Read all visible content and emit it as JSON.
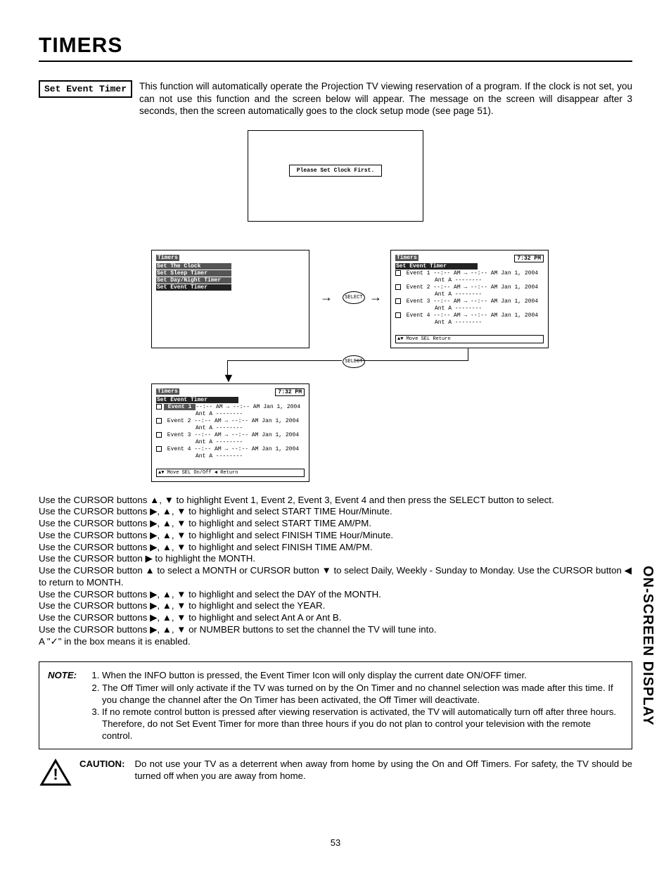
{
  "title": "TIMERS",
  "boxlabel": "Set Event Timer",
  "intro": "This function will automatically operate the Projection TV viewing reservation of a program.  If the clock is not set, you can not use this function and the screen below will appear.  The message on the screen will disappear after 3 seconds, then the screen automatically goes to the clock setup mode (see page 51).",
  "osd_simple": "Please Set Clock First.",
  "menu1": {
    "header": "Timers",
    "items": [
      "Set The Clock",
      "Set Sleep Timer",
      "Set Day/Night Timer",
      "Set Event Timer"
    ]
  },
  "menu2": {
    "header": "Timers",
    "sub": "Set Event Timer",
    "time": "7:32 PM",
    "events": [
      {
        "n": "Event 1",
        "t": "--:-- AM → --:-- AM Jan 1, 2004",
        "sub": "Ant A --------"
      },
      {
        "n": "Event 2",
        "t": "--:-- AM → --:-- AM Jan 1, 2004",
        "sub": "Ant A --------"
      },
      {
        "n": "Event 3",
        "t": "--:-- AM → --:-- AM Jan 1, 2004",
        "sub": "Ant A --------"
      },
      {
        "n": "Event 4",
        "t": "--:-- AM → --:-- AM Jan 1, 2004",
        "sub": "Ant A --------"
      }
    ],
    "footer": "▲▼ Move  SEL Return"
  },
  "menu3": {
    "header": "Timers",
    "sub": "Set Event Timer",
    "time": "7:32 PM",
    "events": [
      {
        "n": "Event 1",
        "t": "--:-- AM → --:-- AM Jan 1, 2004",
        "sub": "Ant A --------",
        "hl": true
      },
      {
        "n": "Event 2",
        "t": "--:-- AM → --:-- AM Jan 1, 2004",
        "sub": "Ant A --------"
      },
      {
        "n": "Event 3",
        "t": "--:-- AM → --:-- AM Jan 1, 2004",
        "sub": "Ant A --------"
      },
      {
        "n": "Event 4",
        "t": "--:-- AM → --:-- AM Jan 1, 2004",
        "sub": "Ant A --------"
      }
    ],
    "footer": "▲▼ Move  SEL On/Off  ◄ Return"
  },
  "select_btn": "SELECT",
  "instructions": [
    "Use the CURSOR buttons ▲, ▼ to highlight Event 1, Event 2, Event 3, Event 4 and then press the SELECT button to select.",
    "Use the CURSOR buttons ▶, ▲, ▼ to highlight and select START TIME Hour/Minute.",
    "Use the CURSOR buttons ▶, ▲, ▼ to highlight and select START TIME AM/PM.",
    "Use the CURSOR buttons ▶, ▲, ▼ to highlight and select FINISH TIME Hour/Minute.",
    "Use the CURSOR buttons ▶, ▲, ▼ to highlight and select FINISH TIME AM/PM.",
    "Use the CURSOR button ▶ to highlight the MONTH.",
    "Use the CURSOR button ▲ to select a MONTH or CURSOR button ▼ to select Daily, Weekly - Sunday to Monday.  Use the CURSOR button ◀ to return to MONTH.",
    "Use the CURSOR buttons ▶, ▲, ▼ to highlight and select the DAY of the MONTH.",
    "Use the CURSOR buttons ▶, ▲, ▼ to highlight and select the YEAR.",
    "Use the CURSOR buttons ▶, ▲, ▼ to highlight and select Ant A or Ant B.",
    "Use the CURSOR buttons ▶, ▲, ▼ or NUMBER buttons to set the channel the TV will tune into.",
    "A \"✓\" in the box means it is enabled."
  ],
  "note_label": "NOTE:",
  "notes": [
    "When the INFO button is pressed, the Event Timer Icon will only display the current date ON/OFF timer.",
    "The Off Timer will only activate if the TV was turned on by the On Timer and no channel selection was made after this time.  If you change the channel after the On Timer has been activated, the Off Timer will deactivate.",
    "If no remote control button is pressed after viewing reservation is activated, the TV will automatically turn off after three hours.  Therefore, do not Set Event Timer for more than three hours if you do not plan to control your television with the remote control."
  ],
  "caution_label": "CAUTION:",
  "caution_text": "Do not use your TV as a deterrent when away from home by using the On and Off Timers.  For safety, the TV should be turned off when you are away from home.",
  "sidetab": "ON-SCREEN DISPLAY",
  "pagenum": "53"
}
